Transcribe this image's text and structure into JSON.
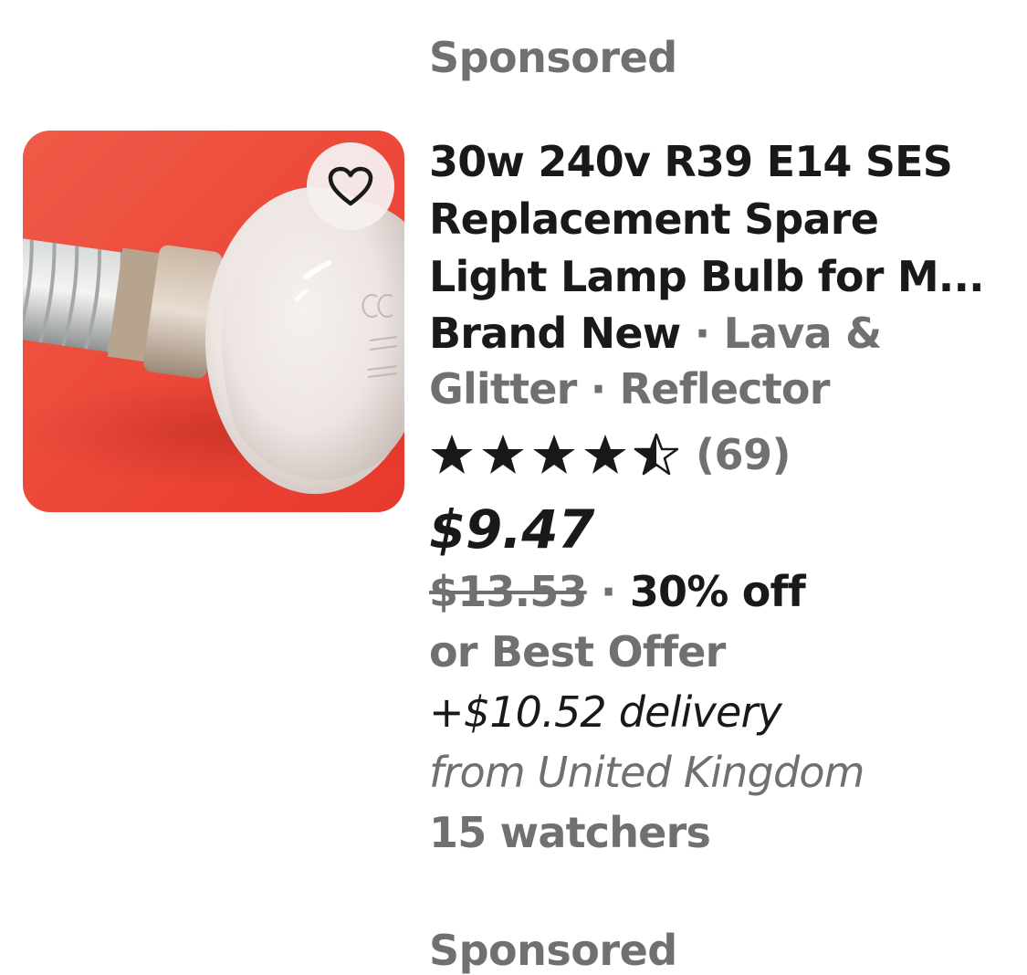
{
  "listing": {
    "sponsored_label": "Sponsored",
    "title_line1": "30w 240v R39 E14 SES",
    "title_line2": "Replacement Spare",
    "title_line3": "Light Lamp Bulb for M...",
    "condition": "Brand New",
    "separator": " · ",
    "attr1_line1": "Lava &",
    "attr1_line2": "Glitter",
    "attr2": "Reflector",
    "rating_stars": 4.5,
    "rating_max": 5,
    "rating_count": "(69)",
    "price": "$9.47",
    "original_price": "$13.53",
    "discount": "30% off",
    "best_offer": "or Best Offer",
    "delivery": "+$10.52 delivery",
    "origin": "from United Kingdom",
    "watchers": "15 watchers",
    "image_alt": "Reflector light bulb",
    "watch_icon": "heart-icon"
  },
  "next_listing": {
    "sponsored_label": "Sponsored"
  },
  "colors": {
    "image_background": "#ef4a3b",
    "text_primary": "#191919",
    "text_secondary": "#707070"
  }
}
